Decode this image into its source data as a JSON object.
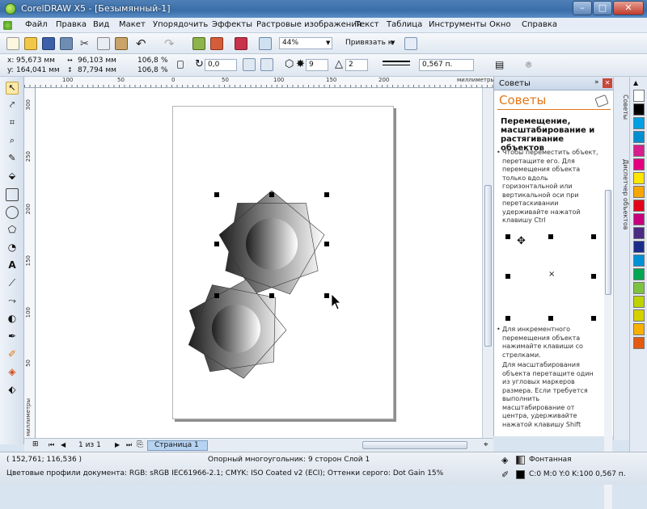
{
  "window": {
    "title": "CorelDRAW X5 - [Безымянный-1]",
    "controls": {
      "minimize": "–",
      "maximize": "□",
      "close": "✕"
    }
  },
  "menu": [
    "Файл",
    "Правка",
    "Вид",
    "Макет",
    "Упорядочить",
    "Эффекты",
    "Растровые изображения",
    "Текст",
    "Таблица",
    "Инструменты",
    "Окно",
    "Справка"
  ],
  "toolbar": {
    "zoom": "44%",
    "snap_label": "Привязать к"
  },
  "property_bar": {
    "x": "95,673 мм",
    "y": "164,041 мм",
    "width": "96,103 мм",
    "height": "87,794 мм",
    "scale_x": "106,8",
    "scale_y": "106,8",
    "scale_unit": "%",
    "angle": "0,0",
    "points": "9",
    "sharpness": "2",
    "outline_width": "0,567 п."
  },
  "rulers": {
    "top_ticks": [
      "100",
      "50",
      "0",
      "50",
      "100",
      "150",
      "200"
    ],
    "top_unit": "миллиметры",
    "left_ticks": [
      "300",
      "250",
      "200",
      "150",
      "100",
      "50"
    ],
    "left_unit": "миллиметры"
  },
  "page_nav": {
    "first": "⏮",
    "prev": "◀",
    "counter": "1 из 1",
    "next": "▶",
    "last": "⏭",
    "tab": "Страница 1"
  },
  "docker": {
    "header": "Советы",
    "title": "Советы",
    "section_title": "Перемещение, масштабирование и растягивание объектов",
    "tips": [
      "Чтобы переместить объект, перетащите его. Для перемещения объекта только вдоль горизонтальной или вертикальной оси при перетаскивании удерживайте нажатой клавишу Ctrl",
      "Для инкрементного перемещения объекта нажимайте клавиши со стрелками.",
      "Для масштабирования объекта перетащите один из угловых маркеров размера. Если требуется выполнить масштабирование от центра, удерживайте нажатой клавишу Shift"
    ]
  },
  "side_tabs": [
    "Советы",
    "Диспетчер объектов"
  ],
  "palette": {
    "colors": [
      "#ffffff",
      "#000000",
      "#00a0e3",
      "#008fd1",
      "#d61e8c",
      "#e5007e",
      "#ffe600",
      "#f7a600",
      "#e2001a",
      "#c8007d",
      "#4b2a83",
      "#1c2c8a",
      "#0091d6",
      "#00a651",
      "#7ec242",
      "#bdd400",
      "#d5d100",
      "#f9b000",
      "#e35a10"
    ]
  },
  "status": {
    "coords": "( 152,761; 116,536 )",
    "object_info": "Опорный многоугольник: 9 сторон Слой 1",
    "color_profiles": "Цветовые профили документа: RGB: sRGB IEC61966-2.1; CMYK: ISO Coated v2 (ECI); Оттенки серого: Dot Gain 15%",
    "fill_label": "Фонтанная",
    "outline_label": "C:0 M:0 Y:0 K:100  0,567 п."
  },
  "colors": {
    "accent_title": "#e0781a",
    "title_bar": "#3a6ea9",
    "page_tab": "#b6d3f1"
  }
}
